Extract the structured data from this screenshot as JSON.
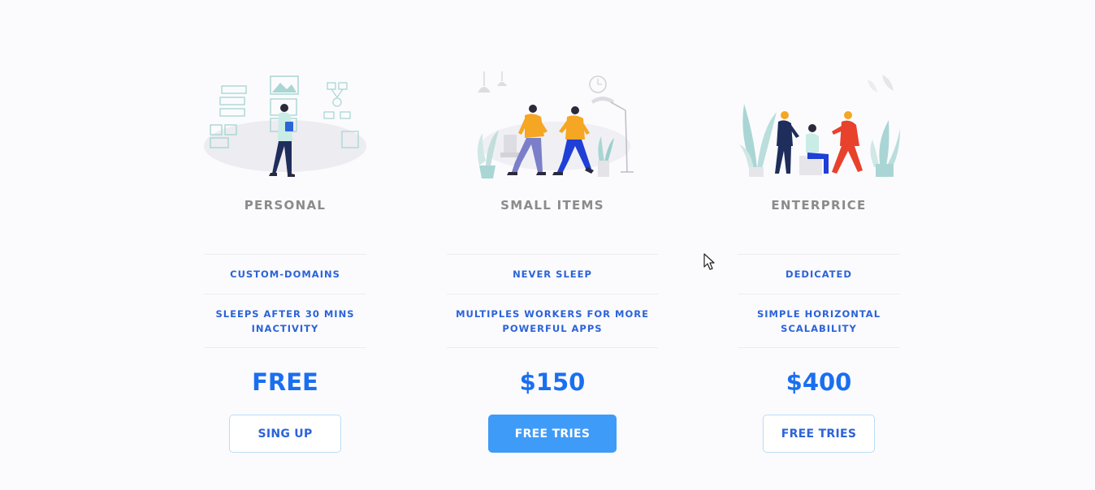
{
  "plans": [
    {
      "name": "PERSONAL",
      "features": [
        "CUSTOM-DOMAINS",
        "SLEEPS AFTER 30 MINS INACTIVITY"
      ],
      "price": "FREE",
      "cta": "SING UP",
      "cta_style": "outline"
    },
    {
      "name": "SMALL ITEMS",
      "features": [
        "NEVER SLEEP",
        "MULTIPLES WORKERS FOR MORE POWERFUL APPS"
      ],
      "price": "$150",
      "cta": "FREE TRIES",
      "cta_style": "filled"
    },
    {
      "name": "ENTERPRICE",
      "features": [
        "DEDICATED",
        "SIMPLE HORIZONTAL SCALABILITY"
      ],
      "price": "$400",
      "cta": "FREE TRIES",
      "cta_style": "outline"
    }
  ],
  "colors": {
    "background": "#fbfbfd",
    "plan_name": "#8b8b8b",
    "feature_text": "#2b63d9",
    "price": "#1a6ff0",
    "button_fill": "#3f9bf8",
    "button_border": "#b9dcf5",
    "accent_orange": "#f5a623",
    "accent_red": "#e8412c",
    "navy": "#1f2d5c",
    "teal_light": "#a9d6d4"
  },
  "icons": [
    "person-walking-illustration",
    "two-people-walking-illustration",
    "team-meeting-illustration",
    "mouse-cursor-icon"
  ]
}
